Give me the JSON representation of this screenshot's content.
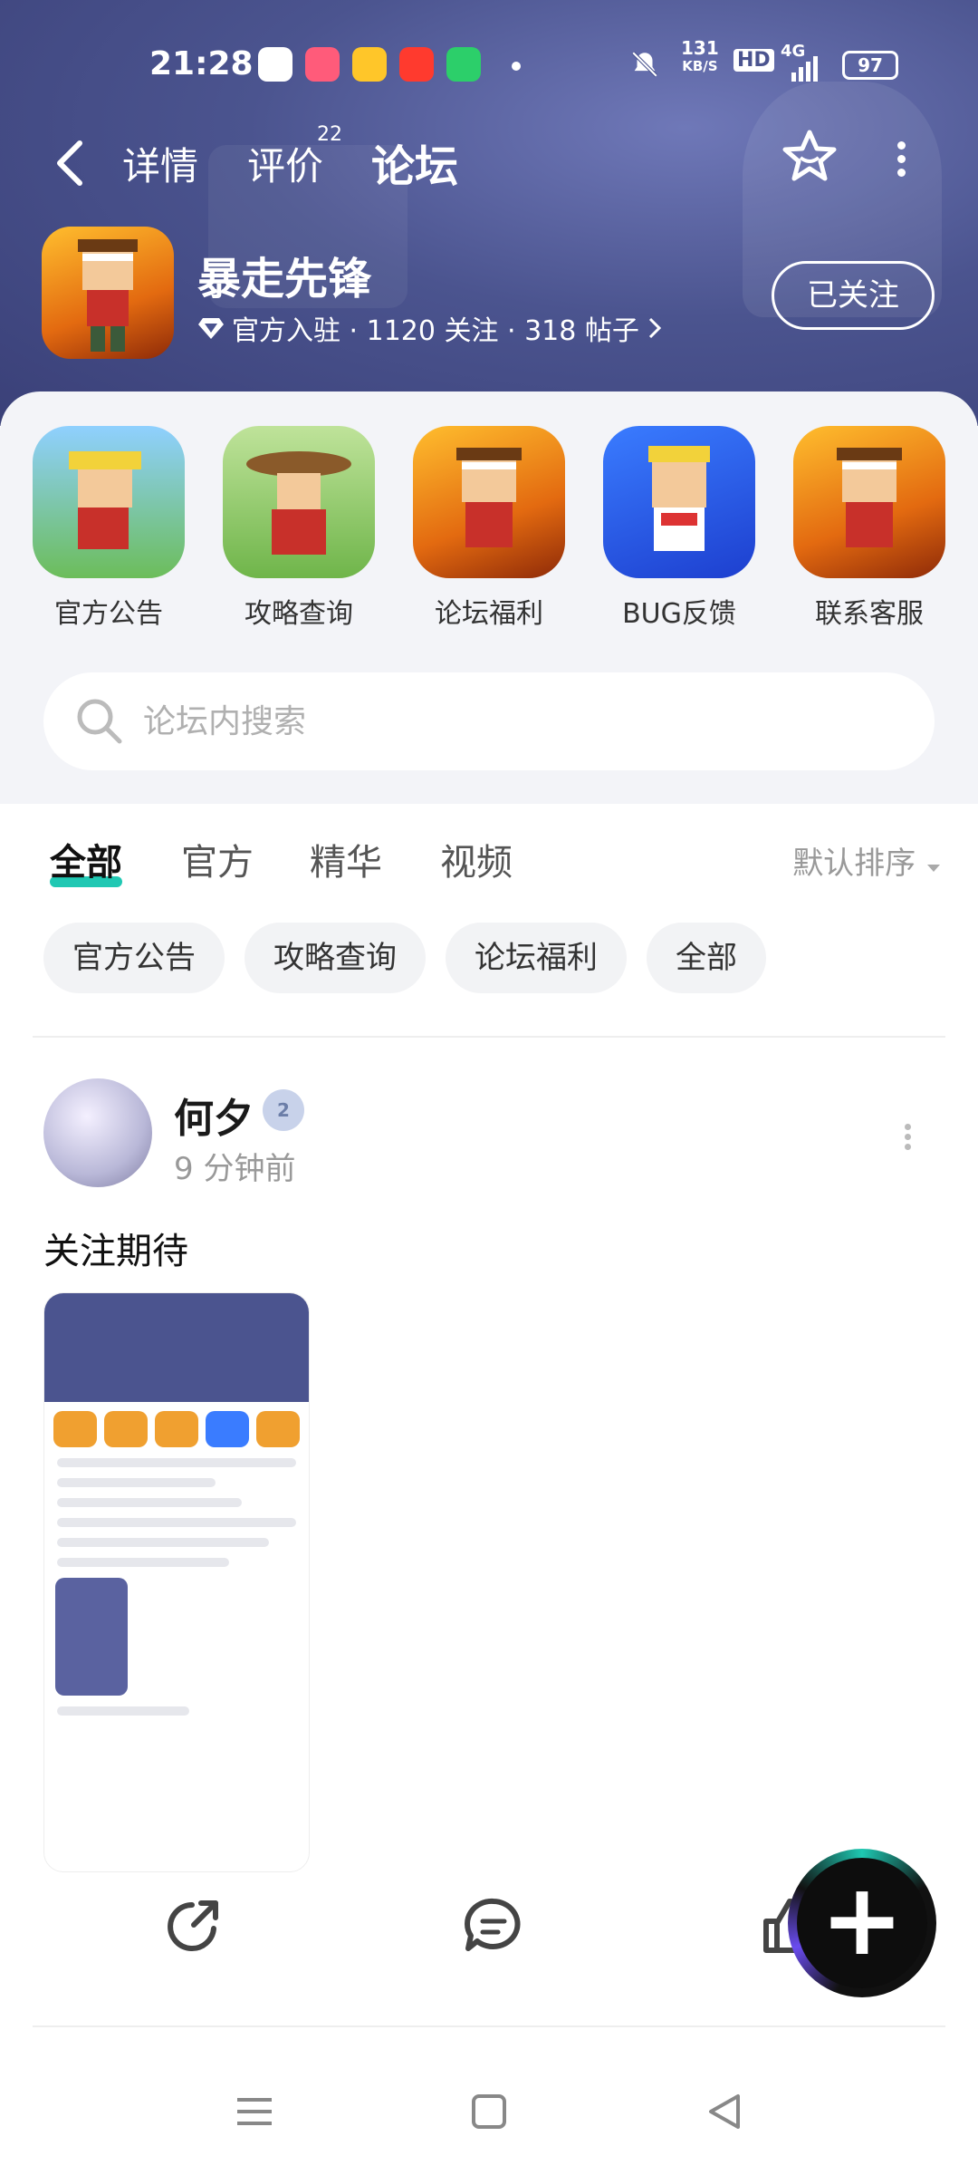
{
  "status_bar": {
    "time": "21:28",
    "net_speed_top": "131",
    "net_speed_unit": "KB/S",
    "hd": "HD",
    "network": "4G",
    "battery": "97"
  },
  "nav": {
    "tabs": [
      {
        "label": "详情"
      },
      {
        "label": "评价",
        "badge": "22"
      },
      {
        "label": "论坛"
      }
    ],
    "active_tab": "论坛"
  },
  "game": {
    "name": "暴走先锋",
    "meta": "官方入驻 · 1120 关注 · 318 帖子",
    "follow_label": "已关注"
  },
  "quick_links": [
    {
      "label": "官方公告"
    },
    {
      "label": "攻略查询"
    },
    {
      "label": "论坛福利"
    },
    {
      "label": "BUG反馈"
    },
    {
      "label": "联系客服"
    }
  ],
  "search": {
    "placeholder": "论坛内搜索"
  },
  "filter_tabs": [
    {
      "label": "全部"
    },
    {
      "label": "官方"
    },
    {
      "label": "精华"
    },
    {
      "label": "视频"
    }
  ],
  "sort_label": "默认排序",
  "chips": [
    {
      "label": "官方公告"
    },
    {
      "label": "攻略查询"
    },
    {
      "label": "论坛福利"
    },
    {
      "label": "全部"
    }
  ],
  "post": {
    "author": "何夕",
    "level": "2",
    "time": "9 分钟前",
    "text": "关注期待"
  },
  "colors": {
    "accent": "#20c8b3",
    "header_bg": "#4b548f"
  }
}
